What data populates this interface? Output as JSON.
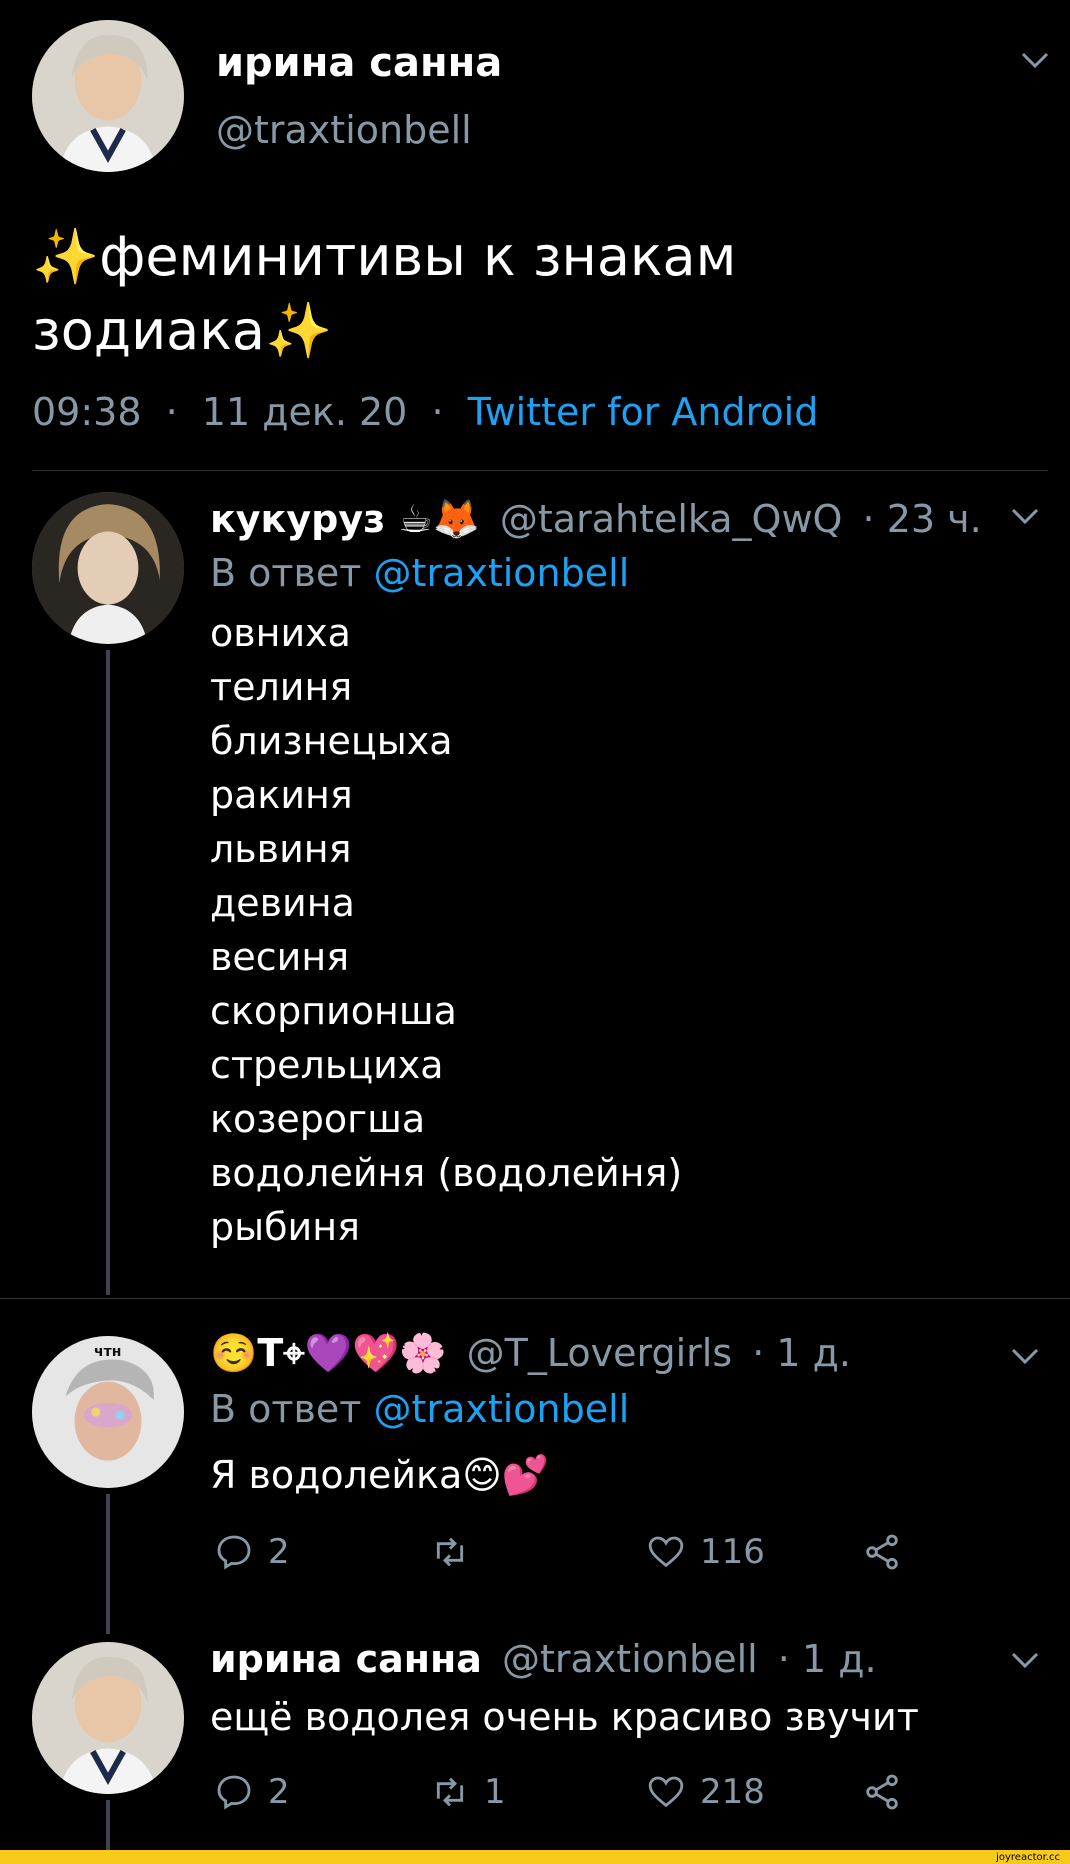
{
  "main_tweet": {
    "display_name": "ирина санна",
    "handle": "@traxtionbell",
    "text_line1": "✨феминитивы к знакам",
    "text_line2": "зодиака✨",
    "time": "09:38",
    "date": "11 дек. 20",
    "client": "Twitter for Android",
    "sep": "·"
  },
  "reply1": {
    "display_name": "кукуруз ☕🦊",
    "handle": "@tarahtelka_QwQ",
    "age": "· 23 ч.",
    "reply_prefix": "В ответ",
    "reply_handle": "@traxtionbell",
    "lines": [
      "овниха",
      "телиня",
      "близнецыха",
      "ракиня",
      "львиня",
      "девина",
      "весиня",
      "скорпионша",
      "стрельциха",
      "козерогша",
      "водолейня (водолейня)",
      "рыбиня"
    ]
  },
  "reply2": {
    "display_name": "☺️T⌖💜💖🌸",
    "handle": "@T_Lovergirls",
    "age": "· 1 д.",
    "reply_prefix": "В ответ",
    "reply_handle": "@traxtionbell",
    "text": "Я водолейка😊💕",
    "avatar_label": "чтн",
    "replies": "2",
    "retweets": "",
    "likes": "116"
  },
  "reply3": {
    "display_name": "ирина санна",
    "handle": "@traxtionbell",
    "age": "· 1 д.",
    "text": "ещё водолея очень красиво звучит",
    "replies": "2",
    "retweets": "1",
    "likes": "218"
  },
  "watermark": "joyreactor.cc",
  "colors": {
    "background": "#000000",
    "link": "#1da1f2",
    "muted": "#8899a6",
    "footer": "#f6c91a"
  }
}
